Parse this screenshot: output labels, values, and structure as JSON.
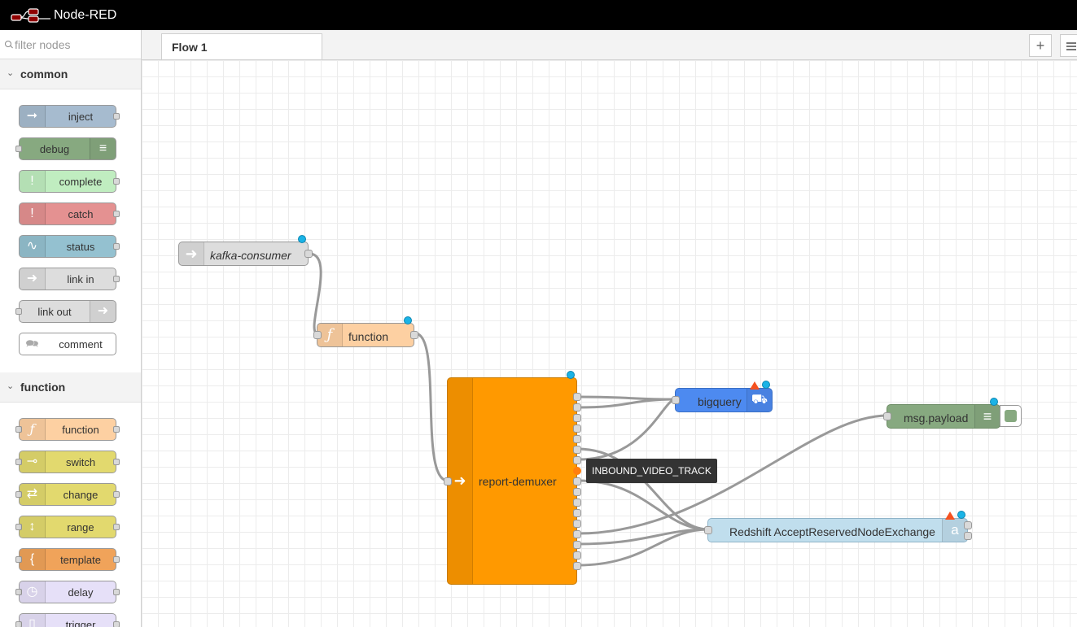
{
  "app": {
    "title": "Node-RED"
  },
  "palette": {
    "filter_placeholder": "filter nodes",
    "categories": [
      {
        "label": "common",
        "nodes": [
          {
            "label": "inject",
            "color": "#a6bbcf"
          },
          {
            "label": "debug",
            "color": "#87a980"
          },
          {
            "label": "complete",
            "color": "#c0edc0"
          },
          {
            "label": "catch",
            "color": "#e49191"
          },
          {
            "label": "status",
            "color": "#94c1d0"
          },
          {
            "label": "link in",
            "color": "#dddddd"
          },
          {
            "label": "link out",
            "color": "#dddddd"
          },
          {
            "label": "comment",
            "color": "#ffffff"
          }
        ]
      },
      {
        "label": "function",
        "nodes": [
          {
            "label": "function",
            "color": "#fdd0a2"
          },
          {
            "label": "switch",
            "color": "#e2d96e"
          },
          {
            "label": "change",
            "color": "#e2d96e"
          },
          {
            "label": "range",
            "color": "#e2d96e"
          },
          {
            "label": "template",
            "color": "#f0a35a"
          },
          {
            "label": "delay",
            "color": "#e6e0f8"
          },
          {
            "label": "trigger",
            "color": "#e6e0f8"
          }
        ]
      }
    ]
  },
  "tabs": [
    {
      "label": "Flow 1",
      "active": true
    }
  ],
  "flow": {
    "nodes": {
      "kafka": {
        "label": "kafka-consumer",
        "color": "#dddddd"
      },
      "function": {
        "label": "function",
        "color": "#fdd0a2"
      },
      "demuxer": {
        "label": "report-demuxer",
        "color": "#ff9900"
      },
      "bigquery": {
        "label": "bigquery",
        "color": "#4d8af0"
      },
      "msgpayload": {
        "label": "msg.payload",
        "color": "#87a980"
      },
      "redshift": {
        "label": "Redshift AcceptReservedNodeExchange",
        "color": "#c0deed"
      }
    },
    "tooltip": "INBOUND_VIDEO_TRACK"
  }
}
